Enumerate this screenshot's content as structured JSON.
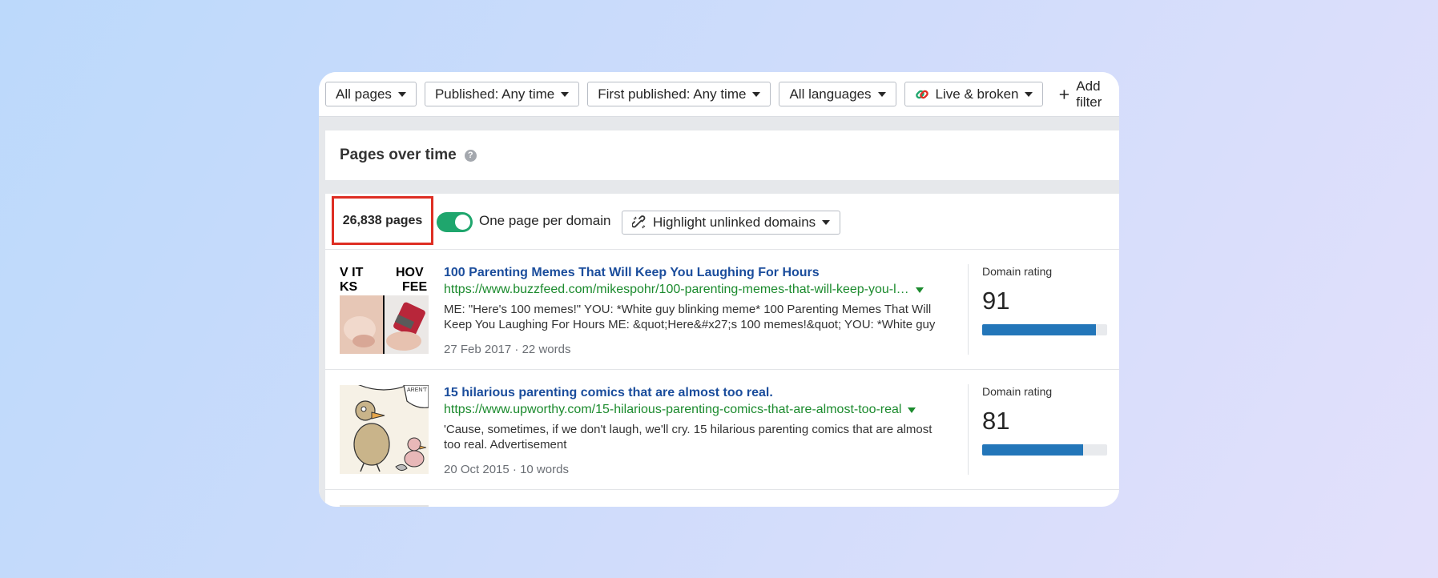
{
  "filters": [
    {
      "label": "All pages"
    },
    {
      "label": "Published: Any time"
    },
    {
      "label": "First published: Any time"
    },
    {
      "label": "All languages"
    },
    {
      "label": "Live & broken"
    }
  ],
  "add_filter_label": "Add filter",
  "pages_over_time": {
    "title": "Pages over time",
    "help": "?"
  },
  "toolbar": {
    "count": "26,838 pages",
    "toggle_label": "One page per domain",
    "toggle_on": true,
    "highlight_label": "Highlight unlinked domains"
  },
  "results": [
    {
      "title": "100 Parenting Memes That Will Keep You Laughing For Hours",
      "url": "https://www.buzzfeed.com/mikespohr/100-parenting-memes-that-will-keep-you-l…",
      "snippet": "ME: \"Here's 100 memes!\" YOU: *White guy blinking meme* 100 Parenting Memes That Will Keep You Laughing For Hours ME: &quot;Here&#x27;s 100 memes!&quot; YOU: *White guy",
      "date": "27 Feb 2017",
      "words": "22 words",
      "dr_label": "Domain rating",
      "dr_value": "91",
      "dr_fraction": 0.91
    },
    {
      "title": "15 hilarious parenting comics that are almost too real.",
      "url": "https://www.upworthy.com/15-hilarious-parenting-comics-that-are-almost-too-real",
      "snippet": "'Cause, sometimes, if we don't laugh, we'll cry. 15 hilarious parenting comics that are almost too real. Advertisement",
      "date": "20 Oct 2015",
      "words": "10 words",
      "dr_label": "Domain rating",
      "dr_value": "81",
      "dr_fraction": 0.81
    }
  ],
  "thumb1_text": {
    "left_top": "V IT",
    "left_bottom": "KS",
    "right_top": "HOV",
    "right_bottom": "FEE"
  },
  "thumb2_text": {
    "bubble": "AREN'T"
  },
  "colors": {
    "link_title": "#1b4d9c",
    "url_green": "#1c8b2e",
    "toggle_green": "#1fa66d",
    "dr_blue": "#2376b9",
    "highlight_red": "#de2e23"
  }
}
